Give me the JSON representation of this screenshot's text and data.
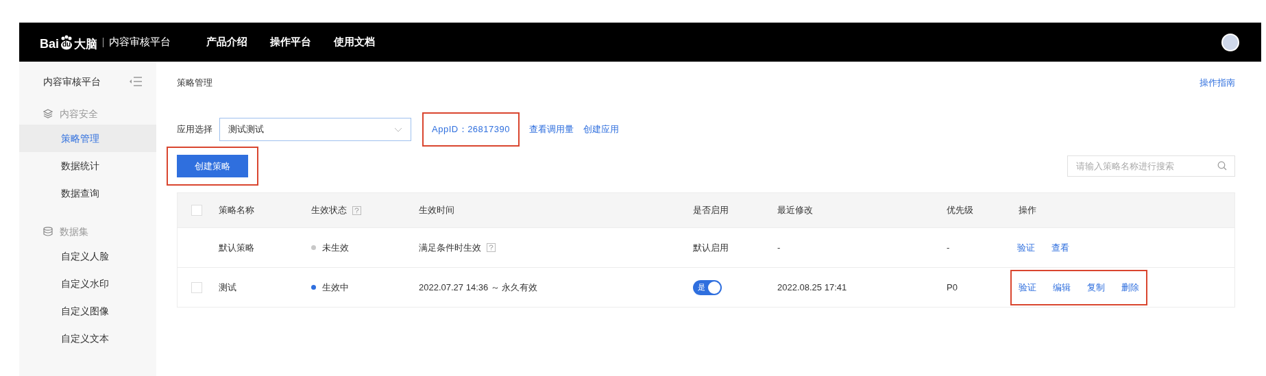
{
  "top_bar": {
    "logo": {
      "parts": [
        "Bai",
        "du",
        "大脑"
      ]
    },
    "platform": "内容审核平台",
    "nav": [
      {
        "label": "产品介绍"
      },
      {
        "label": "操作平台"
      },
      {
        "label": "使用文档"
      }
    ]
  },
  "sidebar": {
    "title": "内容审核平台",
    "groups": [
      {
        "label": "内容安全",
        "items": [
          {
            "label": "策略管理",
            "selected": true
          },
          {
            "label": "数据统计",
            "selected": false
          },
          {
            "label": "数据查询",
            "selected": false
          }
        ]
      },
      {
        "label": "数据集",
        "items": [
          {
            "label": "自定义人脸",
            "selected": false
          },
          {
            "label": "自定义水印",
            "selected": false
          },
          {
            "label": "自定义图像",
            "selected": false
          },
          {
            "label": "自定义文本",
            "selected": false
          }
        ]
      }
    ]
  },
  "page": {
    "title": "策略管理",
    "guide_link": "操作指南",
    "app_select": {
      "label": "应用选择",
      "value": "测试测试"
    },
    "app_id": {
      "text": "AppID：26817390",
      "highlighted": true
    },
    "links": [
      "查看调用量",
      "创建应用"
    ],
    "create_button": {
      "label": "创建策略",
      "highlighted": true
    },
    "search": {
      "placeholder": "请输入策略名称进行搜索"
    }
  },
  "table": {
    "header_checkbox": {
      "checked": false
    },
    "columns": [
      {
        "label": "策略名称",
        "help": false
      },
      {
        "label": "生效状态",
        "help": true
      },
      {
        "label": "生效时间",
        "help": false
      },
      {
        "label": "是否启用",
        "help": false
      },
      {
        "label": "最近修改",
        "help": false
      },
      {
        "label": "优先级",
        "help": false
      },
      {
        "label": "操作",
        "help": false
      }
    ],
    "rows": [
      {
        "name": "默认策略",
        "status": "未生效",
        "color": "#c8c8c8",
        "time": "满足条件时生效",
        "time_help": true,
        "enable": {
          "kind": "text",
          "text": "默认启用"
        },
        "modified": "-",
        "priority": "-",
        "actions": [
          "验证",
          "查看"
        ],
        "actions_highlighted": false
      },
      {
        "checkbox": {
          "checked": false
        },
        "name": "测试",
        "status": "生效中",
        "color": "#2f6fde",
        "time": "2022.07.27 14:36 ～ 永久有效",
        "time_help": false,
        "enable": {
          "kind": "toggle",
          "text": "是",
          "on": true
        },
        "modified": "2022.08.25 17:41",
        "priority": "P0",
        "actions": [
          "验证",
          "编辑",
          "复制",
          "删除"
        ],
        "actions_highlighted": true
      }
    ]
  }
}
